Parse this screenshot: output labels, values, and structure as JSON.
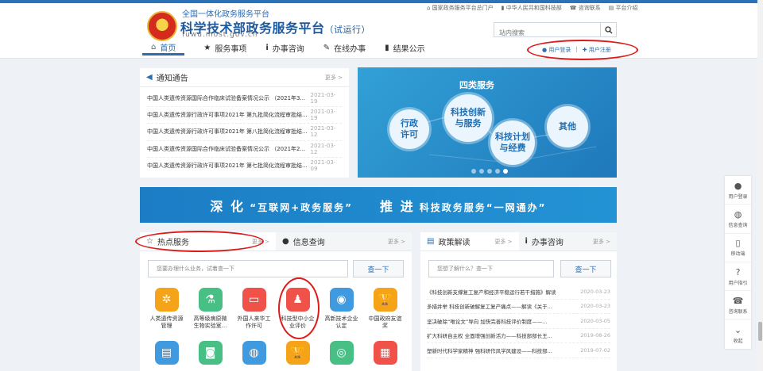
{
  "header": {
    "subtitle": "全国一体化政务服务平台",
    "title": "科学技术部政务服务平台",
    "title_note": "（试运行）",
    "url": "fuwu.most.gov.cn",
    "top_links": [
      "国家政务服务平台总门户",
      "中华人民共和国科技部",
      "咨询联系",
      "平台介绍"
    ],
    "search_placeholder": "站内搜索",
    "nav": [
      "首页",
      "服务事项",
      "办事咨询",
      "在线办事",
      "结果公示"
    ],
    "login": "用户登录",
    "register": "用户注册",
    "separator": "|"
  },
  "notice": {
    "title": "通知通告",
    "more": "更多 >",
    "items": [
      {
        "text": "中国人类遗传资源国际合作临床试验备案情况公示 （2021年3...",
        "date": "2021-03-19"
      },
      {
        "text": "中国人类遗传资源行政许可事项2021年 第九批简化流程审批结...",
        "date": "2021-03-19"
      },
      {
        "text": "中国人类遗传资源行政许可事项2021年 第八批简化流程审批结...",
        "date": "2021-03-12"
      },
      {
        "text": "中国人类遗传资源国际合作临床试验备案情况公示 （2021年2...",
        "date": "2021-03-12"
      },
      {
        "text": "中国人类遗传资源行政许可事项2021年 第七批简化流程审批结...",
        "date": "2021-03-09"
      }
    ]
  },
  "banner": {
    "title": "四类服务",
    "bubbles": [
      {
        "label": "行政\n许可"
      },
      {
        "label": "科技创新\n与服务"
      },
      {
        "label": "科技计划\n与经费"
      },
      {
        "label": "其他"
      }
    ],
    "dots": 5,
    "active_dot": 4
  },
  "slogan": {
    "left_verb": "深 化",
    "left_phrase": "“互联网+政务服务”",
    "right_verb": "推 进",
    "right_phrase": "科技政务服务“一网通办”"
  },
  "services": {
    "tab_hot": "热点服务",
    "tab_info": "信息查询",
    "more": "更多 >",
    "search_placeholder": "您要办理什么业务，试着查一下",
    "search_button": "查一下",
    "items": [
      {
        "name": "人类遗传资源管理",
        "color": "#f5a319"
      },
      {
        "name": "高等级病原微生物实验室...",
        "color": "#48c085"
      },
      {
        "name": "外国人来华工作许可",
        "color": "#f0524a"
      },
      {
        "name": "科技型中小企业评价",
        "color": "#f0524a"
      },
      {
        "name": "高新技术企业认定",
        "color": "#3f9ae0"
      },
      {
        "name": "中国政府友谊奖",
        "color": "#f5a319"
      },
      {
        "name": "",
        "color": "#3f9ae0"
      },
      {
        "name": "",
        "color": "#48c085"
      },
      {
        "name": "",
        "color": "#3f9ae0"
      },
      {
        "name": "",
        "color": "#f5a319"
      },
      {
        "name": "",
        "color": "#48c085"
      },
      {
        "name": "",
        "color": "#f0524a"
      }
    ]
  },
  "policy": {
    "tab_policy": "政策解读",
    "tab_consult": "办事咨询",
    "more": "更多 >",
    "search_placeholder": "您想了解什么？查一下",
    "search_button": "查一下",
    "items": [
      {
        "text": "《科技创新支撑复工复产和经济平稳运行若干措施》解读",
        "date": "2020-03-23"
      },
      {
        "text": "多措并举 科技创新破解复工复产痛点——解读《关于...",
        "date": "2020-03-23"
      },
      {
        "text": "坚决破除“唯论文”导向 加快完善科技评价制度——...",
        "date": "2020-03-05"
      },
      {
        "text": "扩大科研自主权 全面增强创新活力——科技部部长王...",
        "date": "2019-08-26"
      },
      {
        "text": "塑新时代科学家精神 强科研作风学风建设——科技部...",
        "date": "2019-07-02"
      }
    ]
  },
  "sidebar": {
    "items": [
      "用户登录",
      "信息查询",
      "移动端",
      "用户指引",
      "咨询联系",
      "收起"
    ]
  }
}
